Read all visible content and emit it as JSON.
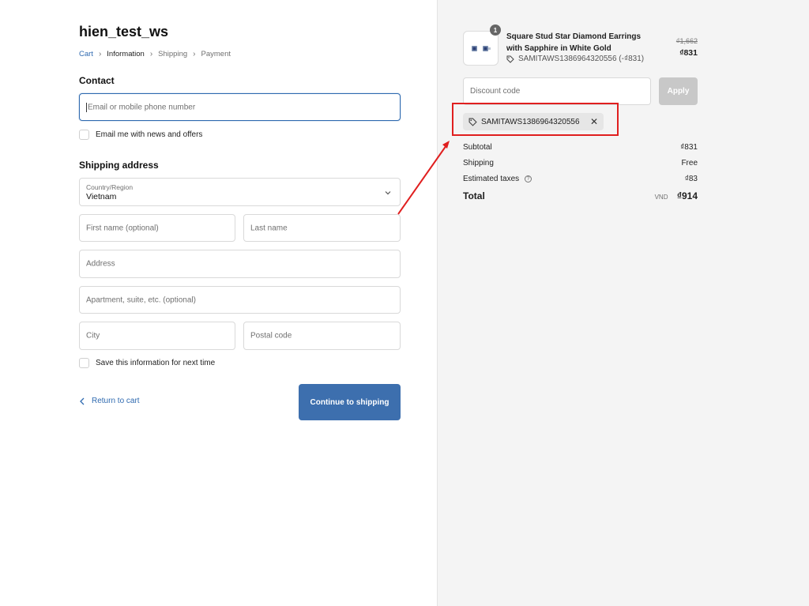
{
  "store": {
    "title": "hien_test_ws"
  },
  "breadcrumb": {
    "items": [
      "Cart",
      "Information",
      "Shipping",
      "Payment"
    ]
  },
  "contact": {
    "title": "Contact",
    "email_placeholder": "Email or mobile phone number",
    "news_label": "Email me with news and offers"
  },
  "shipping": {
    "title": "Shipping address",
    "country_label": "Country/Region",
    "country_value": "Vietnam",
    "first_name_placeholder": "First name (optional)",
    "last_name_placeholder": "Last name",
    "address_placeholder": "Address",
    "apartment_placeholder": "Apartment, suite, etc. (optional)",
    "city_placeholder": "City",
    "postal_placeholder": "Postal code",
    "save_info_label": "Save this information for next time"
  },
  "actions": {
    "return_label": "Return to cart",
    "continue_label": "Continue to shipping"
  },
  "order": {
    "quantity": "1",
    "product_name": "Square Stud Star Diamond Earrings with Sapphire in White Gold",
    "product_discount": "SAMITAWS1386964320556 (-₫831)",
    "price_original": "₫1,662",
    "price_now": "₫831"
  },
  "discount": {
    "placeholder": "Discount code",
    "apply_label": "Apply",
    "applied_code": "SAMITAWS1386964320556"
  },
  "summary": {
    "subtotal_label": "Subtotal",
    "subtotal_value": "₫831",
    "shipping_label": "Shipping",
    "shipping_value": "Free",
    "taxes_label": "Estimated taxes",
    "taxes_value": "₫83",
    "total_label": "Total",
    "total_currency": "VND",
    "total_value": "₫914"
  },
  "colors": {
    "accent": "#3d6fae",
    "link": "#2f6ab0",
    "annotation": "#e01f1f"
  }
}
